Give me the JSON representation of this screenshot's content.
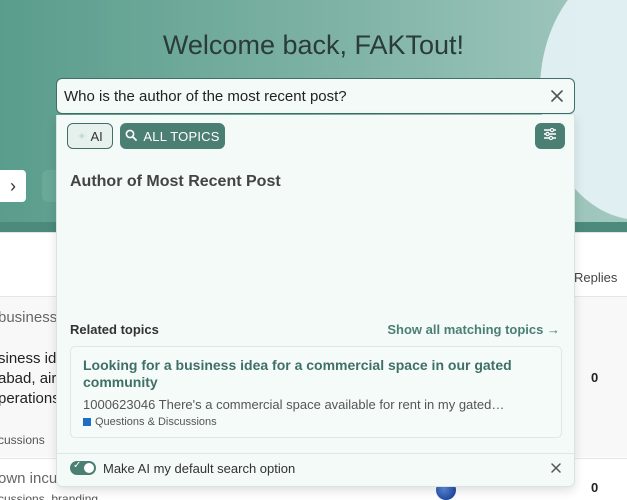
{
  "banner": {
    "welcome": "Welcome back, FAKTout!"
  },
  "search": {
    "value": "Who is the author of the most recent post?",
    "clear_icon": "close-icon"
  },
  "panel": {
    "ai_label": "AI",
    "all_topics_label": "ALL TOPICS",
    "answer_title": "Author of Most Recent Post",
    "related_heading": "Related topics",
    "show_all_label": "Show all matching topics →",
    "topic": {
      "title": "Looking for a business idea for a commercial space in our gated community",
      "excerpt": "1000623046 There's a commercial space available for rent in my gated…",
      "category": "Questions & Discussions",
      "category_color": "#1c6fc2"
    },
    "toggle_label": "Make AI my default search option",
    "toggle_on": true
  },
  "background_list": {
    "replies_header": "Replies",
    "rows": [
      {
        "title_fragment": "business",
        "lines": [
          "siness id",
          "abad, air",
          "perations"
        ],
        "category": "cussions",
        "replies": "0"
      },
      {
        "title_fragment": "own incu",
        "category": "cussions, branding",
        "replies": "0"
      }
    ]
  },
  "colors": {
    "accent": "#4c7f74",
    "banner_start": "#5a9d8c",
    "banner_end": "#a3c9bf"
  }
}
